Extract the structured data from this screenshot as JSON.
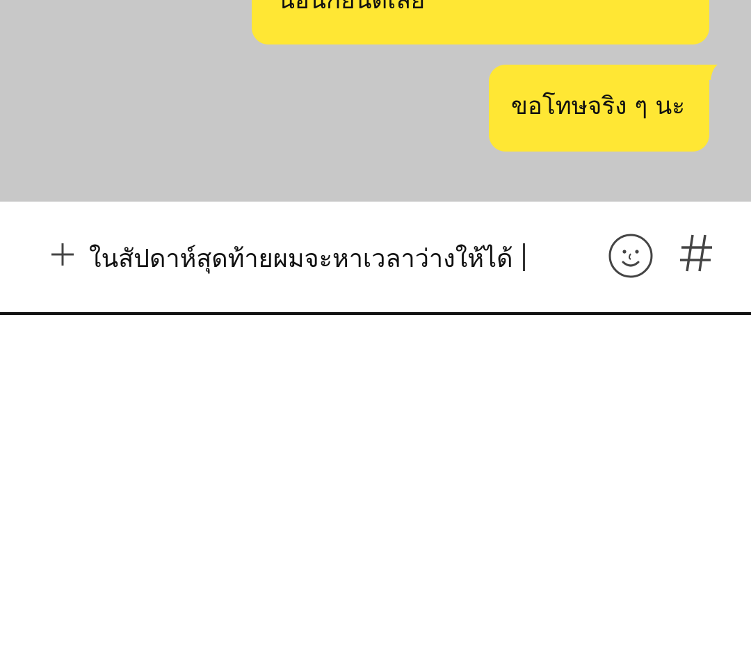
{
  "messages": [
    {
      "text": "น้อนก็ยินดีเลย",
      "sender": "me"
    },
    {
      "text": "ขอโทษจริง ๆ นะ",
      "sender": "me"
    }
  ],
  "composer": {
    "value": "ในสัปดาห์สุดท้ายผมจะหาเวลาว่างให้ได้",
    "plus_icon": "plus-icon",
    "emoji_icon": "smiley-icon",
    "hashtag_icon": "hashtag-icon"
  },
  "colors": {
    "chat_background": "#c8c8c8",
    "bubble": "#ffe734",
    "text": "#111111",
    "icon": "#444444"
  }
}
